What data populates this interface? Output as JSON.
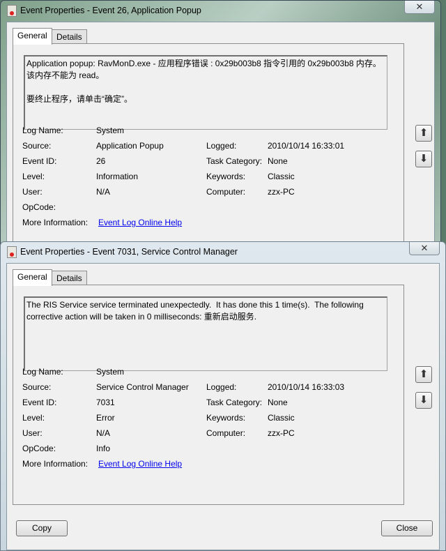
{
  "windows": [
    {
      "title": "Event Properties - Event 26, Application Popup",
      "tabs": [
        "General",
        "Details"
      ],
      "message": "Application popup: RavMonD.exe - 应用程序错误 : 0x29b003b8 指令引用的 0x29b003b8 内存。\n该内存不能为 read。\n\n要终止程序，请单击“确定”。",
      "fields": {
        "log_name_label": "Log Name:",
        "log_name": "System",
        "source_label": "Source:",
        "source": "Application Popup",
        "event_id_label": "Event ID:",
        "event_id": "26",
        "level_label": "Level:",
        "level": "Information",
        "user_label": "User:",
        "user": "N/A",
        "opcode_label": "OpCode:",
        "opcode": "",
        "more_info_label": "More Information:",
        "more_info_link": "Event Log Online Help",
        "logged_label": "Logged:",
        "logged": "2010/10/14 16:33:01",
        "task_label": "Task Category:",
        "task": "None",
        "keywords_label": "Keywords:",
        "keywords": "Classic",
        "computer_label": "Computer:",
        "computer": "zzx-PC"
      }
    },
    {
      "title": "Event Properties - Event 7031, Service Control Manager",
      "tabs": [
        "General",
        "Details"
      ],
      "message": "The RIS Service service terminated unexpectedly.  It has done this 1 time(s).  The following corrective action will be taken in 0 milliseconds: 重新启动服务.",
      "fields": {
        "log_name_label": "Log Name:",
        "log_name": "System",
        "source_label": "Source:",
        "source": "Service Control Manager",
        "event_id_label": "Event ID:",
        "event_id": "7031",
        "level_label": "Level:",
        "level": "Error",
        "user_label": "User:",
        "user": "N/A",
        "opcode_label": "OpCode:",
        "opcode": "Info",
        "more_info_label": "More Information:",
        "more_info_link": "Event Log Online Help",
        "logged_label": "Logged:",
        "logged": "2010/10/14 16:33:03",
        "task_label": "Task Category:",
        "task": "None",
        "keywords_label": "Keywords:",
        "keywords": "Classic",
        "computer_label": "Computer:",
        "computer": "zzx-PC"
      }
    }
  ],
  "buttons": {
    "copy": "Copy",
    "close": "Close"
  },
  "icons": {
    "close": "✕",
    "up": "⬆",
    "down": "⬇"
  }
}
